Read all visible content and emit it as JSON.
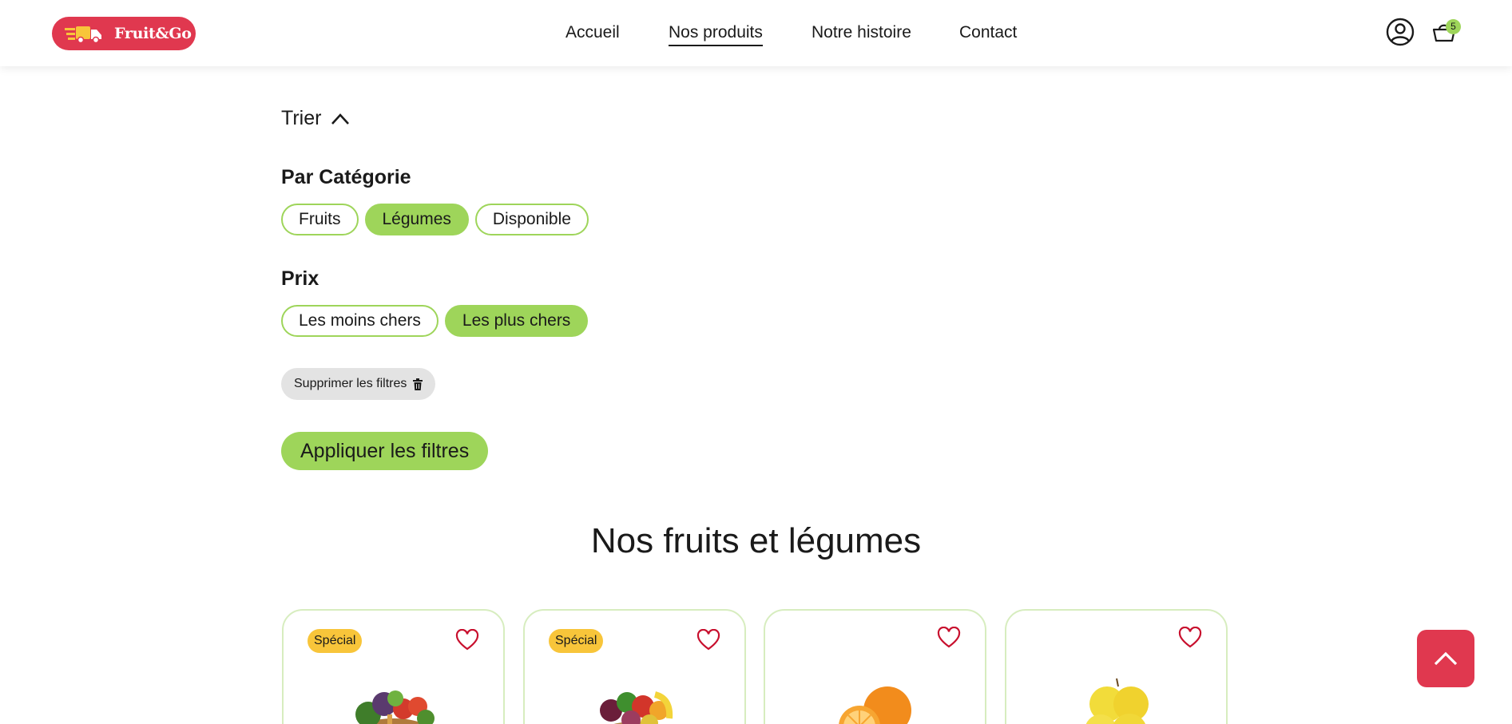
{
  "header": {
    "logo_text": "Fruit&Go",
    "nav": [
      {
        "label": "Accueil"
      },
      {
        "label": "Nos produits",
        "active": true
      },
      {
        "label": "Notre histoire"
      },
      {
        "label": "Contact"
      }
    ],
    "cart_count": "5"
  },
  "filters": {
    "sort_label": "Trier",
    "category_title": "Par Catégorie",
    "categories": [
      {
        "label": "Fruits",
        "selected": false
      },
      {
        "label": "Légumes",
        "selected": true
      },
      {
        "label": "Disponible",
        "selected": false
      }
    ],
    "price_title": "Prix",
    "prices": [
      {
        "label": "Les moins chers",
        "selected": false
      },
      {
        "label": "Les plus chers",
        "selected": true
      }
    ],
    "clear_label": "Supprimer les filtres",
    "apply_label": "Appliquer les filtres"
  },
  "products": {
    "heading": "Nos fruits et légumes",
    "items": [
      {
        "badge": "Spécial",
        "image": "vegetable-basket"
      },
      {
        "badge": "Spécial",
        "image": "fruit-basket"
      },
      {
        "badge": "",
        "image": "oranges"
      },
      {
        "badge": "",
        "image": "yellow-apples"
      }
    ]
  },
  "colors": {
    "brand_red": "#e0384f",
    "accent_green": "#9ed55a",
    "badge_yellow": "#f8c53a",
    "heart_red": "#c8102e"
  }
}
